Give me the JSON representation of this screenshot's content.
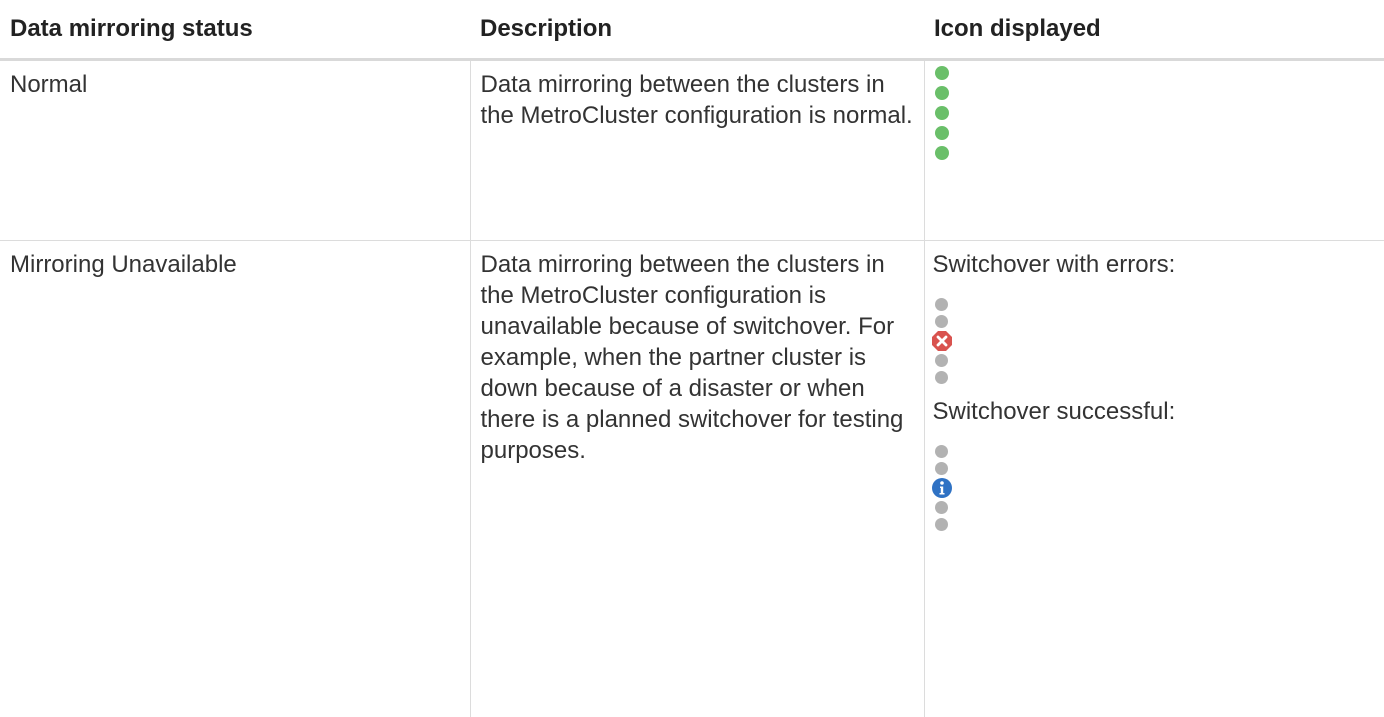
{
  "table": {
    "headers": {
      "status": "Data mirroring status",
      "description": "Description",
      "icon": "Icon displayed"
    },
    "rows": [
      {
        "status": "Normal",
        "description": "Data mirroring between the clusters in the MetroCluster configuration is normal.",
        "icon_states": [
          "green-dot",
          "green-dot",
          "green-dot",
          "green-dot",
          "green-dot"
        ]
      },
      {
        "status": "Mirroring Unavailable",
        "description": "Data mirroring between the clusters in the MetroCluster configuration is unavailable because of switchover. For example, when the partner cluster is down because of a disaster or when there is a planned switchover for testing purposes.",
        "icon_groups": [
          {
            "caption": "Switchover with errors:",
            "icon_states": [
              "gray-dot",
              "gray-dot",
              "error-icon",
              "gray-dot",
              "gray-dot"
            ]
          },
          {
            "caption": "Switchover successful:",
            "icon_states": [
              "gray-dot",
              "gray-dot",
              "info-icon",
              "gray-dot",
              "gray-dot"
            ]
          }
        ]
      }
    ]
  },
  "colors": {
    "green": "#6abf69",
    "gray": "#b2b2b2",
    "error": "#d9534f",
    "info": "#2f72c4",
    "grid": "#dcdcdc"
  }
}
